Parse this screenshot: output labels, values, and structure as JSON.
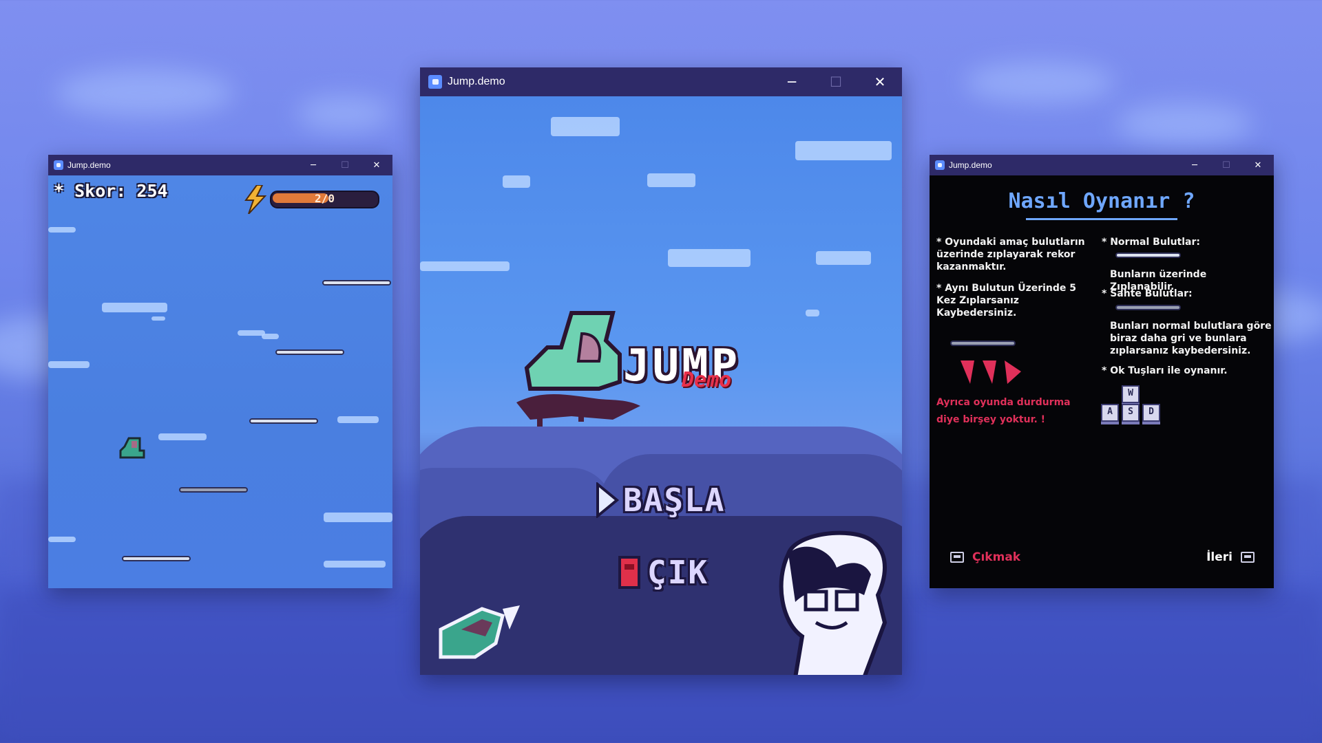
{
  "windows": {
    "left": {
      "title": "Jump.demo",
      "controls": {
        "minimize": "─",
        "maximize": "☐",
        "close": "✕"
      }
    },
    "center": {
      "title": "Jump.demo",
      "controls": {
        "minimize": "─",
        "maximize": "☐",
        "close": "✕"
      }
    },
    "right": {
      "title": "Jump.demo",
      "controls": {
        "minimize": "─",
        "maximize": "☐",
        "close": "✕"
      }
    }
  },
  "gameplay": {
    "score_label": "* Skor: 254",
    "energy_text": "2/0",
    "energy_level": 0.55,
    "energy_color": "#e07a3a",
    "icons": [
      "lightning-bolt-icon",
      "boot-player-icon"
    ]
  },
  "menu": {
    "logo_title": "JUMP",
    "logo_badge": "Demo",
    "start_label": "BAŞLA",
    "exit_label": "ÇIK",
    "icons": [
      "play-triangle-icon",
      "door-icon",
      "boot-mascot-icon",
      "character-face-icon"
    ]
  },
  "help": {
    "title": "Nasıl Oynanır ?",
    "left_col": {
      "goal": "* Oyundaki amaç bulutların üzerinde zıplayarak rekor kazanmaktır.",
      "rule": "* Aynı Bulutun Üzerinde 5 Kez Zıplarsanız Kaybedersiniz.",
      "pause_note_1": "Ayrıca oyunda durdurma",
      "pause_note_2": "diye birşey yoktur. !"
    },
    "right_col": {
      "normal_title": "* Normal Bulutlar:",
      "normal_desc": "Bunların üzerinde Zıplanabilir.",
      "fake_title": "* Sahte Bulutlar:",
      "fake_desc": "Bunları normal bulutlara göre biraz daha gri ve bunlara zıplarsanız kaybedersiniz.",
      "controls_note": "* Ok Tuşları ile oynanır."
    },
    "keys": {
      "up": "W",
      "left": "A",
      "down": "S",
      "right": "D"
    },
    "footer": {
      "back": "Çıkmak",
      "next": "İleri"
    },
    "colors": {
      "title": "#6fa7ff",
      "warning": "#e0305a"
    }
  }
}
